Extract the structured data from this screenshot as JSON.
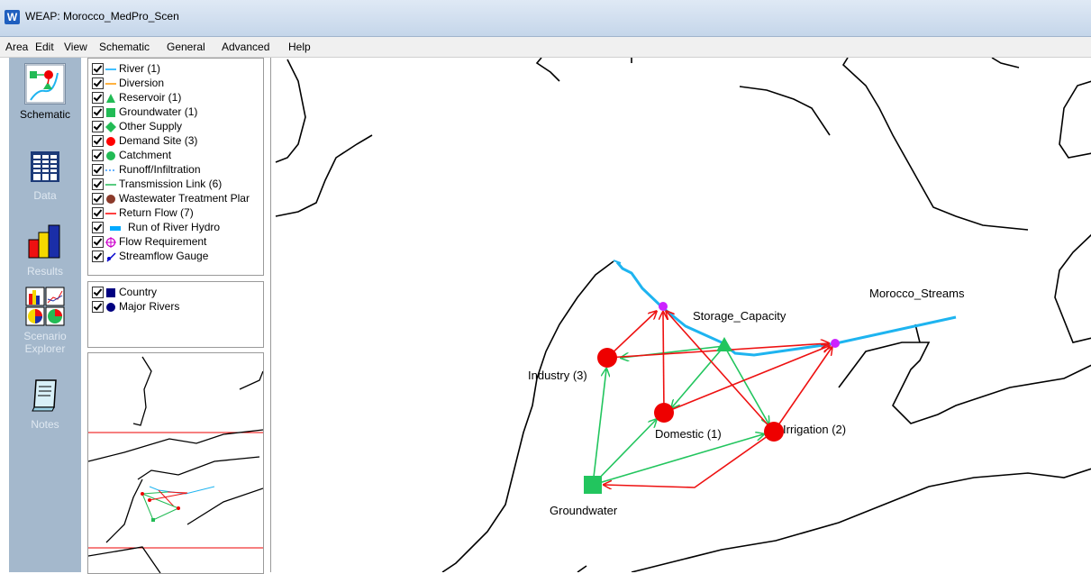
{
  "window": {
    "title": "WEAP: Morocco_MedPro_Scen",
    "app_icon": "W"
  },
  "menu": [
    "Area",
    "Edit",
    "View",
    "Schematic",
    "General",
    "Advanced",
    "Help"
  ],
  "toolbar": {
    "schematic": "Schematic",
    "data": "Data",
    "results": "Results",
    "scenario_line1": "Scenario",
    "scenario_line2": "Explorer",
    "notes": "Notes"
  },
  "legend": [
    {
      "label": "River (1)",
      "icon": "river-line",
      "color": "#00aaff"
    },
    {
      "label": "Diversion",
      "icon": "diversion-line",
      "color": "#ff9900"
    },
    {
      "label": "Reservoir (1)",
      "icon": "reservoir-triangle",
      "color": "#22bb55"
    },
    {
      "label": "Groundwater (1)",
      "icon": "groundwater-square",
      "color": "#22bb55"
    },
    {
      "label": "Other Supply",
      "icon": "other-supply-diamond",
      "color": "#22bb55"
    },
    {
      "label": "Demand Site (3)",
      "icon": "demand-site-circle",
      "color": "#ff0000"
    },
    {
      "label": "Catchment",
      "icon": "catchment-circle",
      "color": "#22bb55"
    },
    {
      "label": "Runoff/Infiltration",
      "icon": "runoff-dashed-line",
      "color": "#3399ff"
    },
    {
      "label": "Transmission Link (6)",
      "icon": "transmission-line",
      "color": "#22bb55"
    },
    {
      "label": "Wastewater Treatment Plar",
      "icon": "wastewater-circle",
      "color": "#8b3a2a"
    },
    {
      "label": "Return Flow (7)",
      "icon": "return-flow-line",
      "color": "#ff0000"
    },
    {
      "label": "Run of River Hydro",
      "icon": "hydro-bar",
      "color": "#00aaff"
    },
    {
      "label": "Flow Requirement",
      "icon": "flow-requirement-icon",
      "color": "#cc00cc"
    },
    {
      "label": "Streamflow Gauge",
      "icon": "streamflow-gauge-icon",
      "color": "#0000cc"
    }
  ],
  "layers": [
    {
      "label": "Country",
      "icon": "country-square",
      "color": "#000080"
    },
    {
      "label": "Major Rivers",
      "icon": "major-rivers-circle",
      "color": "#000080"
    }
  ],
  "schematic": {
    "labels": {
      "storage": "Storage_Capacity",
      "streams": "Morocco_Streams",
      "industry": "Industry (3)",
      "domestic": "Domestic (1)",
      "irrigation": "Irrigation (2)",
      "groundwater": "Groundwater"
    },
    "colors": {
      "river": "#1eb4f0",
      "transmission": "#22c55e",
      "return": "#ee1111",
      "demand": "#ee0000",
      "node": "#cc22ff"
    }
  }
}
